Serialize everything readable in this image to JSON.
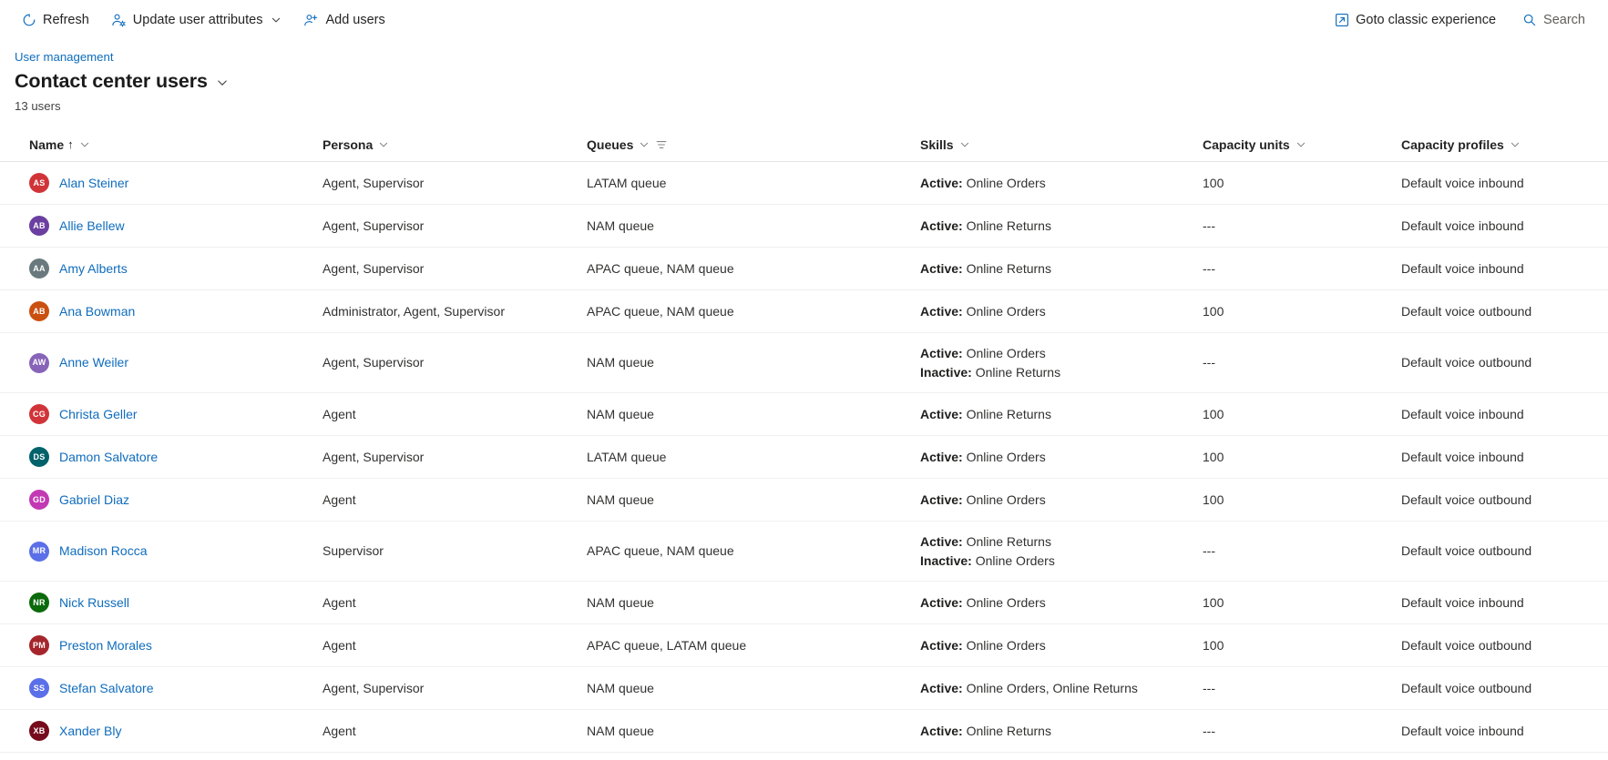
{
  "toolbar": {
    "refresh_label": "Refresh",
    "update_attributes_label": "Update user attributes",
    "add_users_label": "Add users",
    "goto_classic_label": "Goto classic experience",
    "search_label": "Search"
  },
  "header": {
    "breadcrumb": "User management",
    "title": "Contact center users",
    "count": "13 users"
  },
  "columns": {
    "name": "Name",
    "sort_indicator": "↑",
    "persona": "Persona",
    "queues": "Queues",
    "skills": "Skills",
    "capacity_units": "Capacity units",
    "capacity_profiles": "Capacity profiles"
  },
  "colors": {
    "link": "#0f6cbd",
    "text": "#242424"
  },
  "rows": [
    {
      "initials": "AS",
      "avatar_color": "#D13438",
      "name": "Alan Steiner",
      "persona": "Agent, Supervisor",
      "queues": "LATAM queue",
      "skills": [
        {
          "state": "Active:",
          "value": "Online Orders"
        }
      ],
      "capacity_units": "100",
      "capacity_profiles": "Default voice inbound"
    },
    {
      "initials": "AB",
      "avatar_color": "#6B3FA0",
      "name": "Allie Bellew",
      "persona": "Agent, Supervisor",
      "queues": "NAM queue",
      "skills": [
        {
          "state": "Active:",
          "value": "Online Returns"
        }
      ],
      "capacity_units": "---",
      "capacity_profiles": "Default voice inbound"
    },
    {
      "initials": "AA",
      "avatar_color": "#69797E",
      "name": "Amy Alberts",
      "persona": "Agent, Supervisor",
      "queues": "APAC queue, NAM queue",
      "skills": [
        {
          "state": "Active:",
          "value": "Online Returns"
        }
      ],
      "capacity_units": "---",
      "capacity_profiles": "Default voice inbound"
    },
    {
      "initials": "AB",
      "avatar_color": "#CA5010",
      "name": "Ana Bowman",
      "persona": "Administrator, Agent, Supervisor",
      "queues": "APAC queue, NAM queue",
      "skills": [
        {
          "state": "Active:",
          "value": "Online Orders"
        }
      ],
      "capacity_units": "100",
      "capacity_profiles": "Default voice outbound"
    },
    {
      "initials": "AW",
      "avatar_color": "#8764B8",
      "name": "Anne Weiler",
      "persona": "Agent, Supervisor",
      "queues": "NAM queue",
      "skills": [
        {
          "state": "Active:",
          "value": "Online Orders"
        },
        {
          "state": "Inactive:",
          "value": "Online Returns"
        }
      ],
      "capacity_units": "---",
      "capacity_profiles": "Default voice outbound"
    },
    {
      "initials": "CG",
      "avatar_color": "#D13438",
      "name": "Christa Geller",
      "persona": "Agent",
      "queues": "NAM queue",
      "skills": [
        {
          "state": "Active:",
          "value": "Online Returns"
        }
      ],
      "capacity_units": "100",
      "capacity_profiles": "Default voice inbound"
    },
    {
      "initials": "DS",
      "avatar_color": "#00626B",
      "name": "Damon Salvatore",
      "persona": "Agent, Supervisor",
      "queues": "LATAM queue",
      "skills": [
        {
          "state": "Active:",
          "value": "Online Orders"
        }
      ],
      "capacity_units": "100",
      "capacity_profiles": "Default voice inbound"
    },
    {
      "initials": "GD",
      "avatar_color": "#C239B3",
      "name": "Gabriel Diaz",
      "persona": "Agent",
      "queues": "NAM queue",
      "skills": [
        {
          "state": "Active:",
          "value": "Online Orders"
        }
      ],
      "capacity_units": "100",
      "capacity_profiles": "Default voice outbound"
    },
    {
      "initials": "MR",
      "avatar_color": "#5B6FE8",
      "name": "Madison Rocca",
      "persona": "Supervisor",
      "queues": "APAC queue, NAM queue",
      "skills": [
        {
          "state": "Active:",
          "value": "Online Returns"
        },
        {
          "state": "Inactive:",
          "value": "Online Orders"
        }
      ],
      "capacity_units": "---",
      "capacity_profiles": "Default voice outbound"
    },
    {
      "initials": "NR",
      "avatar_color": "#0B6A0B",
      "name": "Nick Russell",
      "persona": "Agent",
      "queues": "NAM queue",
      "skills": [
        {
          "state": "Active:",
          "value": "Online Orders"
        }
      ],
      "capacity_units": "100",
      "capacity_profiles": "Default voice inbound"
    },
    {
      "initials": "PM",
      "avatar_color": "#A4262C",
      "name": "Preston Morales",
      "persona": "Agent",
      "queues": "APAC queue, LATAM queue",
      "skills": [
        {
          "state": "Active:",
          "value": "Online Orders"
        }
      ],
      "capacity_units": "100",
      "capacity_profiles": "Default voice outbound"
    },
    {
      "initials": "SS",
      "avatar_color": "#5B6FE8",
      "name": "Stefan Salvatore",
      "persona": "Agent, Supervisor",
      "queues": "NAM queue",
      "skills": [
        {
          "state": "Active:",
          "value": "Online Orders, Online Returns"
        }
      ],
      "capacity_units": "---",
      "capacity_profiles": "Default voice outbound"
    },
    {
      "initials": "XB",
      "avatar_color": "#750B1C",
      "name": "Xander Bly",
      "persona": "Agent",
      "queues": "NAM queue",
      "skills": [
        {
          "state": "Active:",
          "value": "Online Returns"
        }
      ],
      "capacity_units": "---",
      "capacity_profiles": "Default voice inbound"
    }
  ]
}
